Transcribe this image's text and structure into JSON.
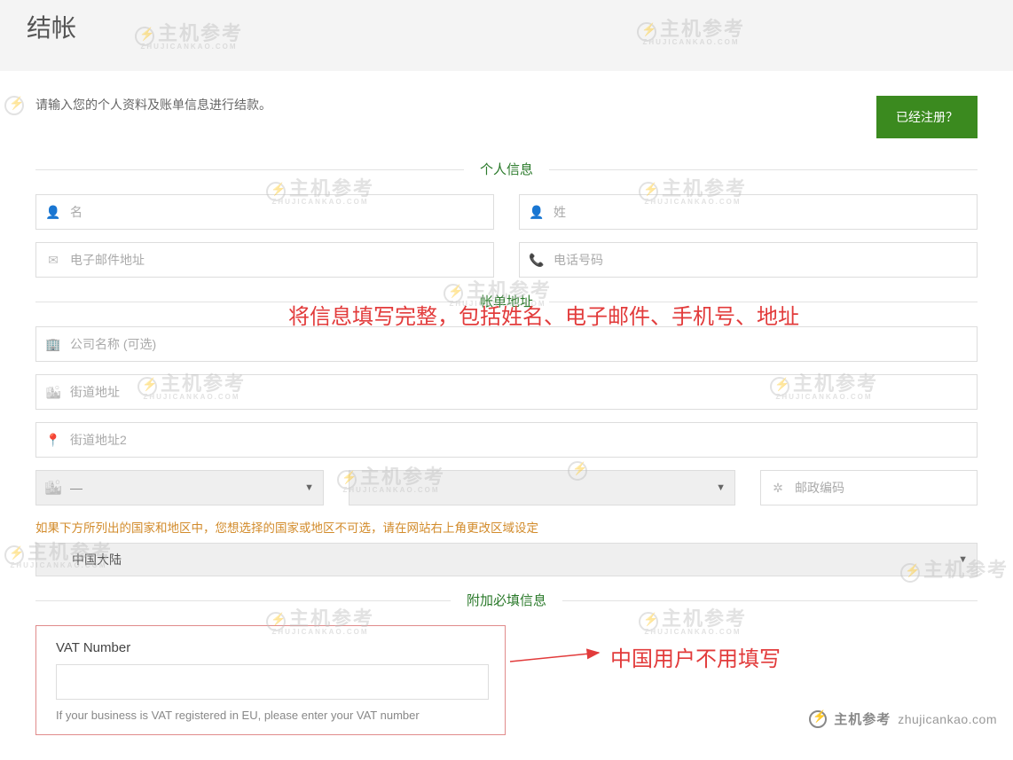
{
  "page": {
    "title": "结帐"
  },
  "intro": {
    "text": "请输入您的个人资料及账单信息进行结款。",
    "registered_button": "已经注册？"
  },
  "sections": {
    "personal": "个人信息",
    "billing": "帐单地址",
    "additional": "附加必填信息"
  },
  "placeholders": {
    "first_name": "名",
    "last_name": "姓",
    "email": "电子邮件地址",
    "phone": "电话号码",
    "company": "公司名称 (可选)",
    "street1": "街道地址",
    "street2": "街道地址2",
    "city_empty": "—",
    "state_empty": " ",
    "postcode": "邮政编码"
  },
  "country": {
    "note": "如果下方所列出的国家和地区中，您想选择的国家或地区不可选，请在网站右上角更改区域设定",
    "selected": "中国大陆"
  },
  "vat": {
    "label": "VAT Number",
    "help": "If your business is VAT registered in EU, please enter your VAT number"
  },
  "annotations": {
    "fill_info": "将信息填写完整，包括姓名、电子邮件、手机号、地址",
    "china_skip": "中国用户不用填写"
  },
  "watermark": {
    "cn": "主机参考",
    "en": "ZHUJICANKAO.COM",
    "domain": "zhujicankao.com"
  }
}
